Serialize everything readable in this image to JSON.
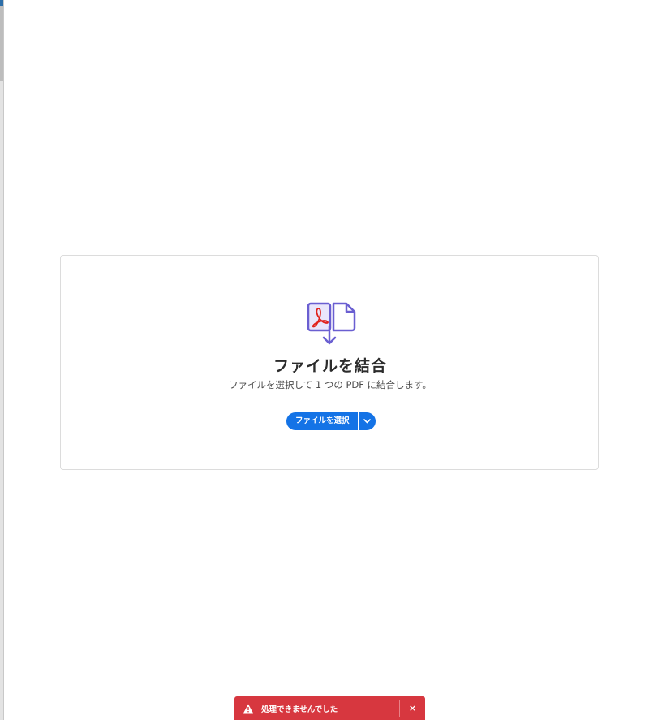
{
  "dropzone": {
    "title": "ファイルを結合",
    "description": "ファイルを選択して 1 つの PDF に結合します。",
    "select_button_label": "ファイルを選択",
    "dropdown_icon": "chevron-down-icon",
    "icon": "combine-files-icon"
  },
  "toast": {
    "message": "処理できませんでした",
    "status_icon": "alert-icon",
    "close_label": "×",
    "color": "#d7373f"
  },
  "colors": {
    "accent": "#1473e6",
    "icon_stroke": "#6a5fd1",
    "pdf_red": "#e0211b"
  }
}
